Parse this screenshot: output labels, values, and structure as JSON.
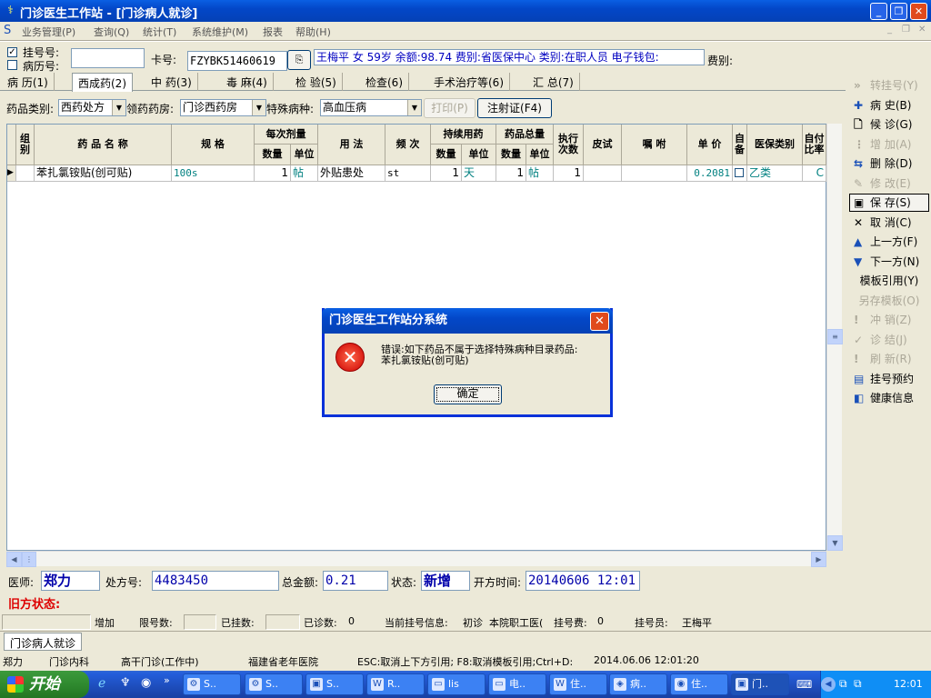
{
  "window": {
    "title": "门诊医生工作站 - [门诊病人就诊]",
    "min": "_",
    "max": "❐",
    "close": "✕"
  },
  "menu": {
    "items": [
      "业务管理(P)",
      "查询(Q)",
      "统计(T)",
      "系统维护(M)",
      "报表",
      "帮助(H)"
    ],
    "mdi_controls": [
      "_",
      "❐",
      "✕"
    ]
  },
  "top": {
    "reg_no_label": "挂号号:",
    "history_no_label": "病历号:",
    "card_label": "卡号:",
    "card_value": "FZYBK51460619",
    "patient_info": "王梅平 女 59岁 余额:98.74 费别:省医保中心 类别:在职人员 电子钱包:",
    "fee_type_label": "费别:"
  },
  "tabs": [
    "病 历(1)",
    "西成药(2)",
    "中 药(3)",
    "毒 麻(4)",
    "检 验(5)",
    "检查(6)",
    "手术治疗等(6)",
    "汇 总(7)"
  ],
  "filter": {
    "drug_type_label": "药品类别:",
    "drug_type_value": "西药处方",
    "pharmacy_label": "领药药房:",
    "pharmacy_value": "门诊西药房",
    "disease_label": "特殊病种:",
    "disease_value": "高血压病",
    "print_button": "打印(P)",
    "injection_button": "注射证(F4)"
  },
  "grid": {
    "headers": {
      "group": "组别",
      "name": "药 品 名 称",
      "spec": "规 格",
      "dose_group": "每次剂量",
      "qty": "数量",
      "unit": "单位",
      "usage": "用 法",
      "freq": "频 次",
      "cont_group": "持续用药",
      "cont_qty": "数量",
      "cont_unit": "单位",
      "total_group": "药品总量",
      "total_qty": "数量",
      "total_unit": "单位",
      "exec": "执行次数",
      "skin": "皮试",
      "note": "嘱 咐",
      "price": "单 价",
      "self_prep": "自备",
      "insurance": "医保类别",
      "self_pay": "自付比率"
    },
    "rows": [
      {
        "marker": "▶",
        "group": "",
        "name": "苯扎氯铵贴(创可贴)",
        "spec": "100s",
        "qty": "1",
        "unit": "帖",
        "usage": "外贴患处",
        "freq": "st",
        "cont_qty": "1",
        "cont_unit": "天",
        "total_qty": "1",
        "total_unit": "帖",
        "exec": "1",
        "skin": "",
        "note": "",
        "price": "0.2081",
        "insurance": "乙类",
        "self_pay": "C"
      }
    ]
  },
  "right_buttons": [
    {
      "label": "转挂号(Y)",
      "icon": "»",
      "enabled": false
    },
    {
      "label": "病 史(B)",
      "icon": "✚",
      "enabled": true
    },
    {
      "label": "候 诊(G)",
      "icon": "🗋",
      "enabled": true
    },
    {
      "label": "增 加(A)",
      "icon": "⋮",
      "enabled": false
    },
    {
      "label": "删 除(D)",
      "icon": "⇆",
      "enabled": true
    },
    {
      "label": "修 改(E)",
      "icon": "✎",
      "enabled": false
    },
    {
      "label": "保 存(S)",
      "icon": "▣",
      "enabled": true
    },
    {
      "label": "取 消(C)",
      "icon": "✕",
      "enabled": true
    },
    {
      "label": "上一方(F)",
      "icon": "▲",
      "enabled": true
    },
    {
      "label": "下一方(N)",
      "icon": "▼",
      "enabled": true
    },
    {
      "label": "模板引用(Y)",
      "icon": "",
      "enabled": true
    },
    {
      "label": "另存模板(O)",
      "icon": "",
      "enabled": false
    },
    {
      "label": "冲 销(Z)",
      "icon": "!",
      "enabled": false
    },
    {
      "label": "诊 结(J)",
      "icon": "✓",
      "enabled": false
    },
    {
      "label": "刷 新(R)",
      "icon": "!",
      "enabled": false
    },
    {
      "label": "挂号预约",
      "icon": "▤",
      "enabled": true
    },
    {
      "label": "健康信息",
      "icon": "◧",
      "enabled": true
    }
  ],
  "bottom": {
    "doctor_label": "医师:",
    "doctor_value": "郑力",
    "rx_no_label": "处方号:",
    "rx_no_value": "4483450",
    "total_label": "总金额:",
    "total_value": "0.21",
    "status_label": "状态:",
    "status_value": "新增",
    "time_label": "开方时间:",
    "time_value": "20140606 12:01",
    "old_status_label": "旧方状态:"
  },
  "status2": {
    "add": "增加",
    "limit_label": "限号数:",
    "registered_label": "已挂数:",
    "seen_label": "已诊数:",
    "seen_value": "0",
    "current_reg_label": "当前挂号信息:",
    "visit_type": "初诊",
    "staff": "本院职工医(",
    "fee_label": "挂号费:",
    "fee_value": "0",
    "registrar_label": "挂号员:",
    "registrar_value": "王梅平"
  },
  "window_tab": "门诊病人就诊",
  "statusbar": {
    "user": "郑力",
    "dept": "门诊内科",
    "room": "高干门诊(工作中)",
    "hospital": "福建省老年医院",
    "hint": "ESC:取消上下方引用; F8:取消模板引用;Ctrl+D:",
    "datetime": "2014.06.06 12:01:20"
  },
  "dialog": {
    "title": "门诊医生工作站分系统",
    "message_line1": "错误:如下药品不属于选择特殊病种目录药品:",
    "message_line2": "苯扎氯铵贴(创可贴)",
    "ok": "确定"
  },
  "taskbar": {
    "start": "开始",
    "tasks": [
      "S..",
      "S..",
      "S..",
      "R..",
      "lis",
      "电..",
      "住..",
      "病..",
      "住..",
      "门.."
    ],
    "clock": "12:01"
  }
}
